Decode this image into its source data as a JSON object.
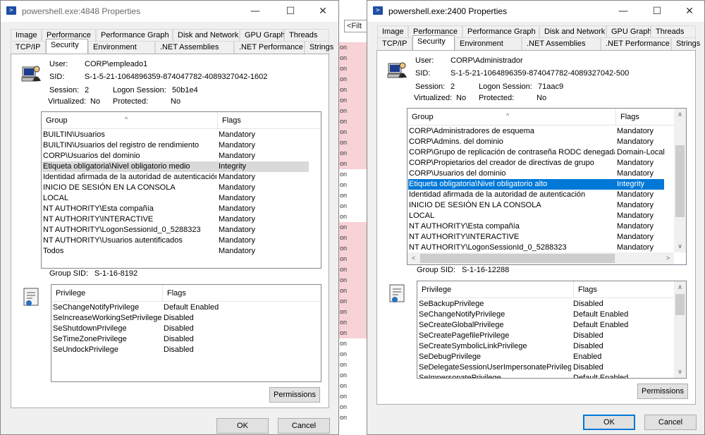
{
  "background": {
    "filter_text": "<Filt",
    "row_text": "on"
  },
  "left_dialog": {
    "title": "powershell.exe:4848 Properties",
    "tabs_row1": [
      "Image",
      "Performance",
      "Performance Graph",
      "Disk and Network",
      "GPU Graph",
      "Threads"
    ],
    "tabs_row2": [
      "TCP/IP",
      "Security",
      "Environment",
      ".NET Assemblies",
      ".NET Performance",
      "Strings"
    ],
    "active_tab": "Security",
    "user_label": "User:",
    "user_value": "CORP\\empleado1",
    "sid_label": "SID:",
    "sid_value": "S-1-5-21-1064896359-874047782-4089327042-1602",
    "session_label": "Session:",
    "session_value": "2",
    "logon_session_label": "Logon Session:",
    "logon_session_value": "50b1e4",
    "virtualized_label": "Virtualized:",
    "virtualized_value": "No",
    "protected_label": "Protected:",
    "protected_value": "No",
    "groups_header": [
      "Group",
      "Flags"
    ],
    "groups": [
      {
        "group": "BUILTIN\\Usuarios",
        "flags": "Mandatory"
      },
      {
        "group": "BUILTIN\\Usuarios del registro de rendimiento",
        "flags": "Mandatory"
      },
      {
        "group": "CORP\\Usuarios del dominio",
        "flags": "Mandatory"
      },
      {
        "group": "Etiqueta obligatoria\\Nivel obligatorio medio",
        "flags": "Integrity"
      },
      {
        "group": "Identidad afirmada de la autoridad de autenticación",
        "flags": "Mandatory"
      },
      {
        "group": "INICIO DE SESIÓN EN LA CONSOLA",
        "flags": "Mandatory"
      },
      {
        "group": "LOCAL",
        "flags": "Mandatory"
      },
      {
        "group": "NT AUTHORITY\\Esta compañía",
        "flags": "Mandatory"
      },
      {
        "group": "NT AUTHORITY\\INTERACTIVE",
        "flags": "Mandatory"
      },
      {
        "group": "NT AUTHORITY\\LogonSessionId_0_5288323",
        "flags": "Mandatory"
      },
      {
        "group": "NT AUTHORITY\\Usuarios autentificados",
        "flags": "Mandatory"
      },
      {
        "group": "Todos",
        "flags": "Mandatory"
      }
    ],
    "group_sid_label": "Group SID:",
    "group_sid_value": "S-1-16-8192",
    "privileges_header": [
      "Privilege",
      "Flags"
    ],
    "privileges": [
      {
        "privilege": "SeChangeNotifyPrivilege",
        "flags": "Default Enabled"
      },
      {
        "privilege": "SeIncreaseWorkingSetPrivilege",
        "flags": "Disabled"
      },
      {
        "privilege": "SeShutdownPrivilege",
        "flags": "Disabled"
      },
      {
        "privilege": "SeTimeZonePrivilege",
        "flags": "Disabled"
      },
      {
        "privilege": "SeUndockPrivilege",
        "flags": "Disabled"
      }
    ],
    "permissions_label": "Permissions",
    "ok_label": "OK",
    "cancel_label": "Cancel"
  },
  "right_dialog": {
    "title": "powershell.exe:2400 Properties",
    "tabs_row1": [
      "Image",
      "Performance",
      "Performance Graph",
      "Disk and Network",
      "GPU Graph",
      "Threads"
    ],
    "tabs_row2": [
      "TCP/IP",
      "Security",
      "Environment",
      ".NET Assemblies",
      ".NET Performance",
      "Strings"
    ],
    "active_tab": "Security",
    "user_label": "User:",
    "user_value": "CORP\\Administrador",
    "sid_label": "SID:",
    "sid_value": "S-1-5-21-1064896359-874047782-4089327042-500",
    "session_label": "Session:",
    "session_value": "2",
    "logon_session_label": "Logon Session:",
    "logon_session_value": "71aac9",
    "virtualized_label": "Virtualized:",
    "virtualized_value": "No",
    "protected_label": "Protected:",
    "protected_value": "No",
    "groups_header": [
      "Group",
      "Flags"
    ],
    "groups": [
      {
        "group": "CORP\\Administradores de esquema",
        "flags": "Mandatory"
      },
      {
        "group": "CORP\\Admins. del dominio",
        "flags": "Mandatory"
      },
      {
        "group": "CORP\\Grupo de replicación de contraseña RODC denegada",
        "flags": "Domain-Local"
      },
      {
        "group": "CORP\\Propietarios del creador de directivas de grupo",
        "flags": "Mandatory"
      },
      {
        "group": "CORP\\Usuarios del dominio",
        "flags": "Mandatory"
      },
      {
        "group": "Etiqueta obligatoria\\Nivel obligatorio alto",
        "flags": "Integrity"
      },
      {
        "group": "Identidad afirmada de la autoridad de autenticación",
        "flags": "Mandatory"
      },
      {
        "group": "INICIO DE SESIÓN EN LA CONSOLA",
        "flags": "Mandatory"
      },
      {
        "group": "LOCAL",
        "flags": "Mandatory"
      },
      {
        "group": "NT AUTHORITY\\Esta compañía",
        "flags": "Mandatory"
      },
      {
        "group": "NT AUTHORITY\\INTERACTIVE",
        "flags": "Mandatory"
      },
      {
        "group": "NT AUTHORITY\\LogonSessionId_0_5288323",
        "flags": "Mandatory"
      }
    ],
    "group_sid_label": "Group SID:",
    "group_sid_value": "S-1-16-12288",
    "privileges_header": [
      "Privilege",
      "Flags"
    ],
    "privileges": [
      {
        "privilege": "SeBackupPrivilege",
        "flags": "Disabled"
      },
      {
        "privilege": "SeChangeNotifyPrivilege",
        "flags": "Default Enabled"
      },
      {
        "privilege": "SeCreateGlobalPrivilege",
        "flags": "Default Enabled"
      },
      {
        "privilege": "SeCreatePagefilePrivilege",
        "flags": "Disabled"
      },
      {
        "privilege": "SeCreateSymbolicLinkPrivilege",
        "flags": "Disabled"
      },
      {
        "privilege": "SeDebugPrivilege",
        "flags": "Enabled"
      },
      {
        "privilege": "SeDelegateSessionUserImpersonatePrivilege",
        "flags": "Disabled"
      },
      {
        "privilege": "SeImpersonatePrivilege",
        "flags": "Default Enabled"
      }
    ],
    "permissions_label": "Permissions",
    "ok_label": "OK",
    "cancel_label": "Cancel"
  },
  "titlebar_buttons": {
    "minimize": "—",
    "maximize": "☐",
    "close": "✕"
  }
}
